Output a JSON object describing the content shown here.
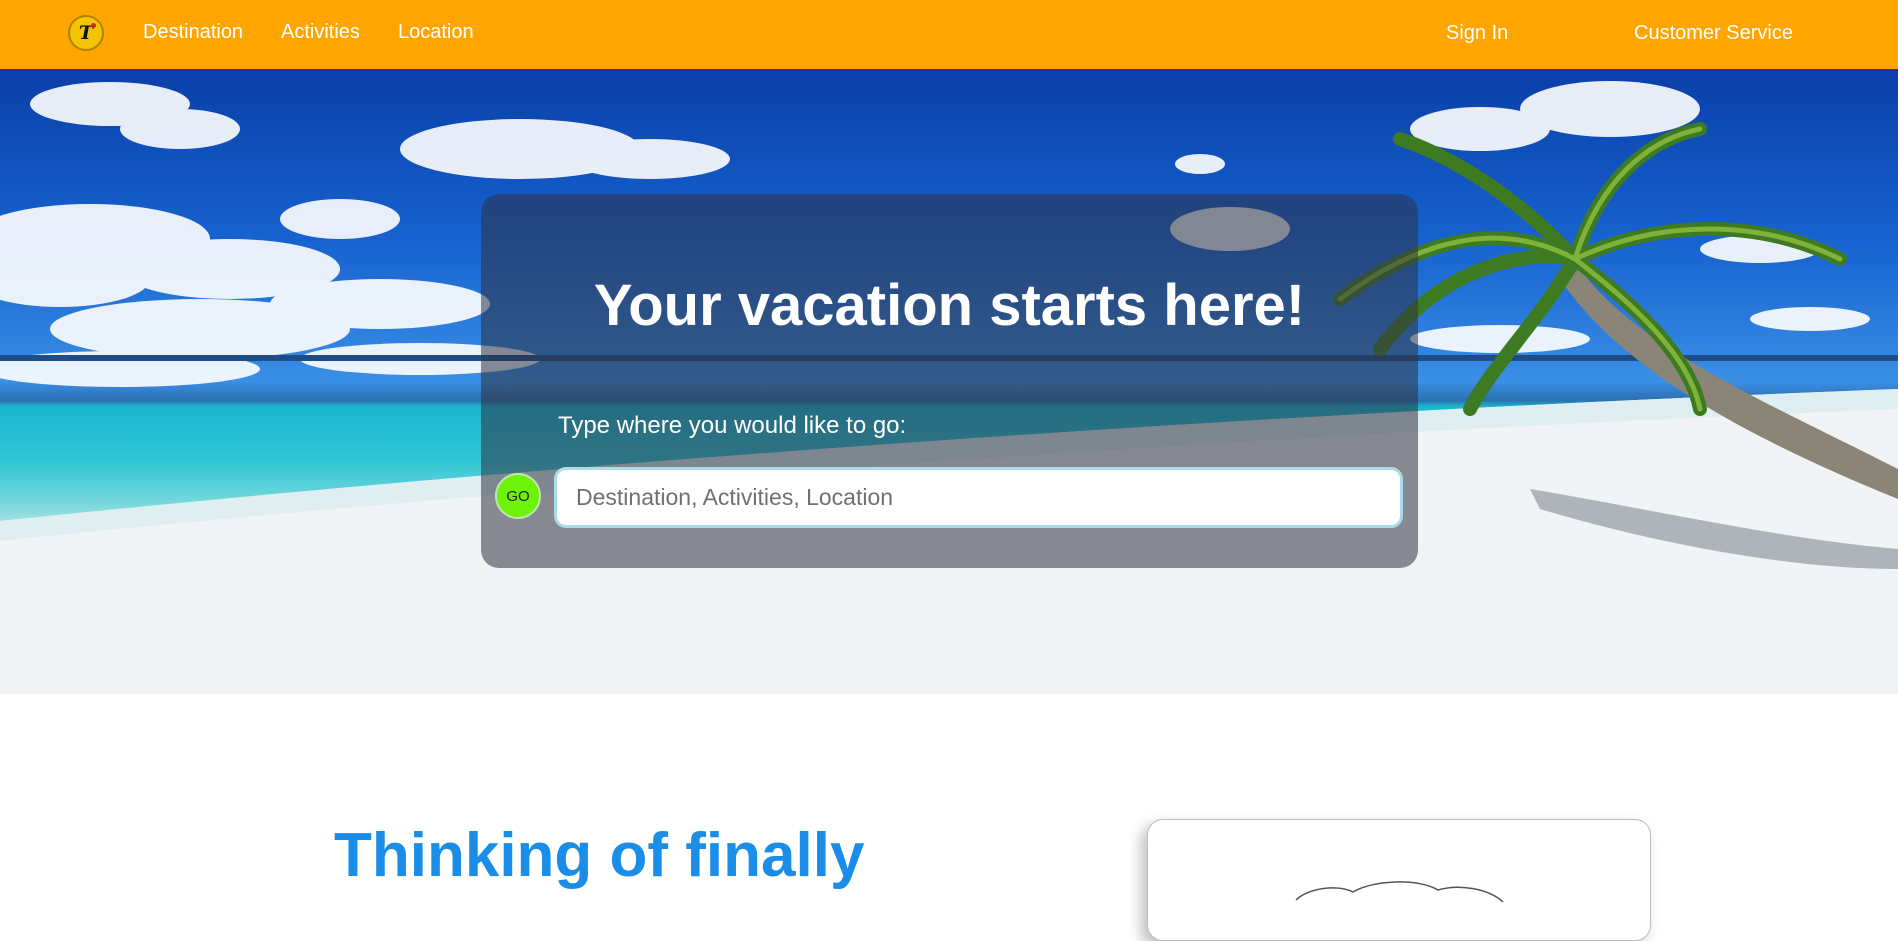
{
  "nav": {
    "logo_letter": "T",
    "links": [
      "Destination",
      "Activities",
      "Location"
    ],
    "sign_in": "Sign In",
    "customer_service": "Customer Service",
    "bar_color": "#ffa500"
  },
  "hero": {
    "headline": "Your vacation starts here!",
    "prompt": "Type where you would like to go:",
    "go_label": "GO",
    "search_placeholder": "Destination, Activities, Location",
    "search_value": "",
    "go_color": "#6ef20a"
  },
  "promo": {
    "title": "Thinking of finally",
    "title_color": "#1a8de8",
    "card_icon": "cloud-icon"
  }
}
